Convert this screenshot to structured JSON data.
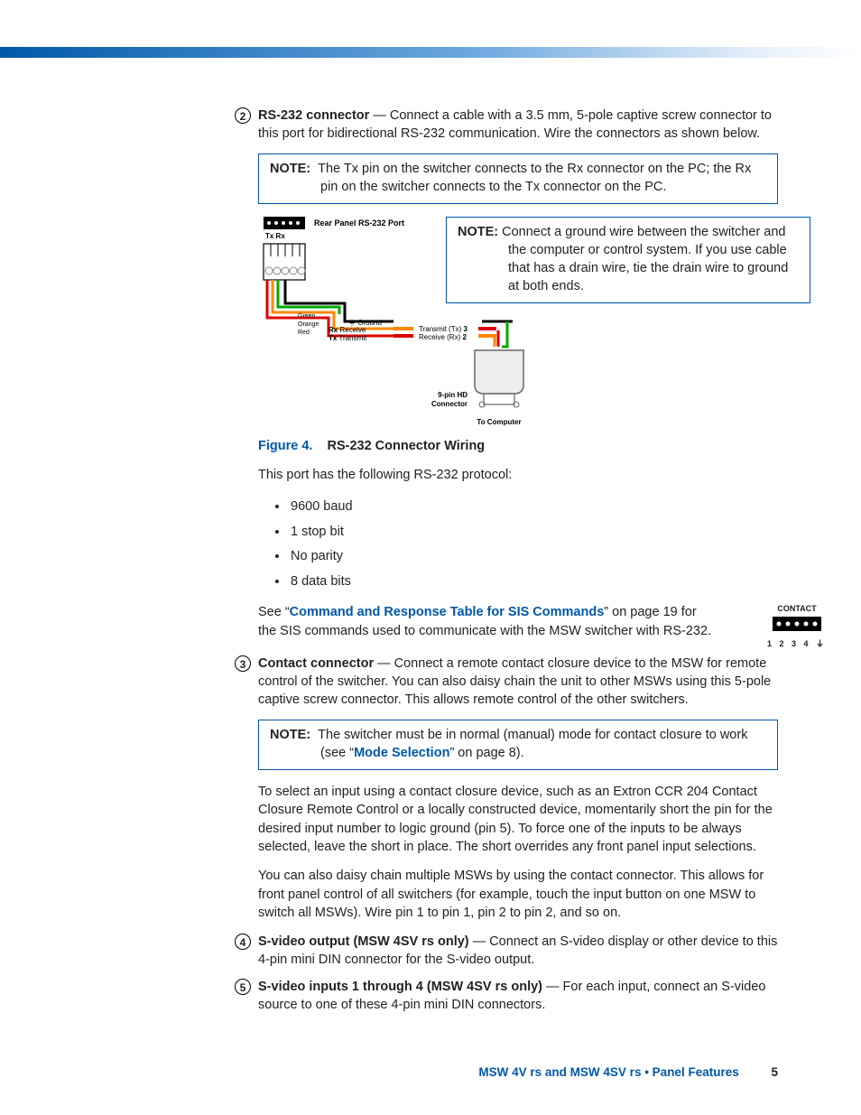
{
  "items": {
    "i2": {
      "num": "2",
      "title": "RS-232 connector",
      "text": " — Connect a cable with a 3.5 mm, 5-pole captive screw connector to this port for bidirectional RS-232 communication. Wire the connectors as shown below."
    },
    "i3": {
      "num": "3",
      "title": "Contact connector",
      "text": " — Connect a remote contact closure device to the MSW for remote control of the switcher. You can also daisy chain the unit to other MSWs using this 5-pole captive screw connector. This allows remote control of the other switchers."
    },
    "i4": {
      "num": "4",
      "title": "S-video output (MSW 4SV rs only)",
      "text": " — Connect an S-video display or other device to this 4-pin mini DIN connector for the S-video output."
    },
    "i5": {
      "num": "5",
      "title": "S-video inputs 1 through 4 (MSW 4SV rs only)",
      "text": " — For each input, connect an S-video source to one of these 4-pin mini DIN connectors."
    }
  },
  "notes": {
    "n1": {
      "label": "NOTE:",
      "text": "The Tx pin on the switcher connects to the Rx connector on the PC; the Rx pin on the switcher connects to the Tx connector on the PC."
    },
    "n2": {
      "label": "NOTE:",
      "text": "Connect a ground wire between the switcher and the computer or control system. If you use cable that has a drain wire, tie the drain wire to ground at both ends."
    },
    "n3": {
      "label": "NOTE:",
      "pre": "The switcher must be in normal (manual) mode for contact closure to work (see “",
      "link": "Mode Selection",
      "post": "” on page 8)."
    }
  },
  "diagram": {
    "port_title": "Rear Panel RS-232 Port",
    "txrx": "Tx Rx",
    "green": "Green",
    "orange": "Orange",
    "red": "Red",
    "ground": "Ground",
    "rx": "Rx",
    "receive": "Receive",
    "tx": "Tx",
    "transmit": "Transmit",
    "txpin": "Transmit (Tx)",
    "txpin_n": "3",
    "rxpin": "Receive (Rx)",
    "rxpin_n": "2",
    "hd": "9-pin HD\nConnector",
    "tocomp": "To Computer"
  },
  "figure": {
    "label": "Figure 4.",
    "caption": "RS-232 Connector Wiring"
  },
  "protocol": {
    "intro": "This port has the following RS-232 protocol:",
    "items": [
      "9600 baud",
      "1 stop bit",
      "No parity",
      "8 data bits"
    ]
  },
  "see": {
    "pre": "See “",
    "link": "Command and Response Table for SIS Commands",
    "post": "” on page 19 for the SIS commands used to communicate with the MSW switcher with RS-232."
  },
  "contact_fig": {
    "title": "CONTACT",
    "pins": "1  2  3  4"
  },
  "contact_paras": {
    "p1": "To select an input using a contact closure device, such as an Extron CCR 204 Contact Closure Remote Control or a locally constructed device, momentarily short the pin for the desired input number to logic ground (pin 5). To force one of the inputs to be always selected, leave the short in place. The short overrides any front panel input selections.",
    "p2": "You can also daisy chain multiple MSWs by using the contact connector. This allows for front panel control of all switchers (for example, touch the input button on one MSW to switch all MSWs). Wire pin 1 to pin 1, pin 2 to pin 2, and so on."
  },
  "footer": {
    "text": "MSW 4V rs and MSW 4SV rs • Panel Features",
    "page": "5"
  }
}
